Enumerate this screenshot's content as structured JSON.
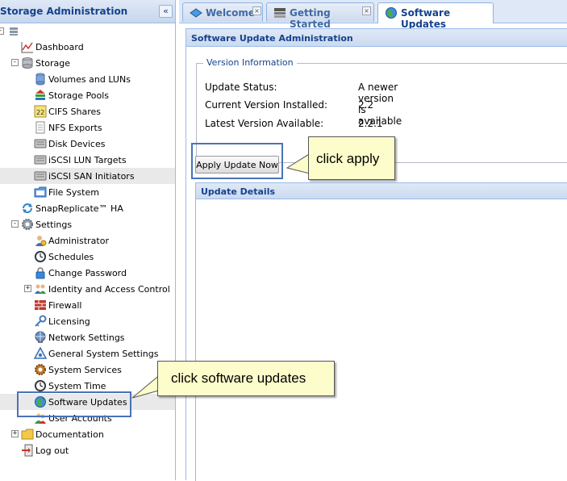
{
  "sidebar": {
    "title": "Storage Administration",
    "collapse_glyph": "«",
    "items": [
      {
        "label": "",
        "icon": "server-icon"
      },
      {
        "label": "Dashboard",
        "icon": "dashboard-icon"
      },
      {
        "label": "Storage",
        "icon": "storage-icon"
      },
      {
        "label": "Volumes and LUNs",
        "icon": "volume-icon"
      },
      {
        "label": "Storage Pools",
        "icon": "storage-pool-icon"
      },
      {
        "label": "CIFS Shares",
        "icon": "cifs-icon"
      },
      {
        "label": "NFS Exports",
        "icon": "nfs-icon"
      },
      {
        "label": "Disk Devices",
        "icon": "disk-icon"
      },
      {
        "label": "iSCSI LUN Targets",
        "icon": "iscsi-target-icon"
      },
      {
        "label": "iSCSI SAN Initiators",
        "icon": "iscsi-initiator-icon"
      },
      {
        "label": "File System",
        "icon": "folder-icon"
      },
      {
        "label": "SnapReplicate™ HA",
        "icon": "replicate-icon"
      },
      {
        "label": "Settings",
        "icon": "gear-icon"
      },
      {
        "label": "Administrator",
        "icon": "admin-icon"
      },
      {
        "label": "Schedules",
        "icon": "clock-icon"
      },
      {
        "label": "Change Password",
        "icon": "lock-icon"
      },
      {
        "label": "Identity and Access Control",
        "icon": "identity-icon"
      },
      {
        "label": "Firewall",
        "icon": "firewall-icon"
      },
      {
        "label": "Licensing",
        "icon": "key-icon"
      },
      {
        "label": "Network Settings",
        "icon": "network-icon"
      },
      {
        "label": "General System Settings",
        "icon": "system-settings-icon"
      },
      {
        "label": "System Services",
        "icon": "services-icon"
      },
      {
        "label": "System Time",
        "icon": "clock-icon"
      },
      {
        "label": "Software Updates",
        "icon": "globe-update-icon"
      },
      {
        "label": "User Accounts",
        "icon": "users-icon"
      },
      {
        "label": "Documentation",
        "icon": "folder-icon"
      },
      {
        "label": "Log out",
        "icon": "logout-icon"
      }
    ]
  },
  "tabs": [
    {
      "label": "Welcome",
      "icon": "welcome-icon"
    },
    {
      "label": "Getting Started",
      "icon": "getting-started-icon"
    },
    {
      "label": "Software Updates",
      "icon": "globe-update-icon"
    }
  ],
  "main": {
    "title": "Software Update Administration",
    "version_info": {
      "legend": "Version Information",
      "rows": [
        {
          "label": "Update Status:",
          "value": "A newer version is available"
        },
        {
          "label": "Current Version Installed:",
          "value": "2.2"
        },
        {
          "label": "Latest Version Available:",
          "value": "2.2.1"
        }
      ]
    },
    "apply_button": "Apply Update Now",
    "update_details_title": "Update Details"
  },
  "annotations": {
    "apply_callout": "click apply",
    "software_updates_callout": "click software updates"
  },
  "colors": {
    "accent": "#15428b",
    "border": "#99bbe8",
    "callout_bg": "#fdfdcb",
    "highlight": "#4a72b8"
  }
}
